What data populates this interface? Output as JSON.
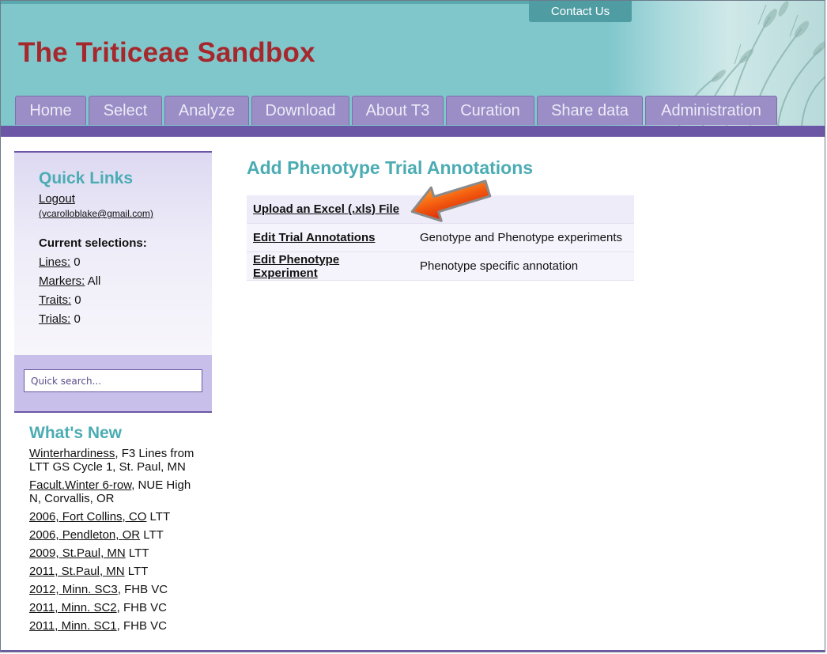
{
  "header": {
    "site_title": "The Triticeae Sandbox",
    "contact_label": "Contact Us",
    "nav_tabs": [
      "Home",
      "Select",
      "Analyze",
      "Download",
      "About T3",
      "Curation",
      "Share data",
      "Administration"
    ]
  },
  "quick_links": {
    "heading": "Quick Links",
    "logout_label": "Logout",
    "user_email": "(vcarolloblake@gmail.com)",
    "current_selections_label": "Current selections:",
    "selections": [
      {
        "label": "Lines:",
        "value": " 0"
      },
      {
        "label": "Markers:",
        "value": " All"
      },
      {
        "label": "Traits:",
        "value": " 0"
      },
      {
        "label": "Trials:",
        "value": " 0"
      }
    ]
  },
  "search": {
    "placeholder": "Quick search..."
  },
  "whats_new": {
    "heading": "What's New",
    "items": [
      {
        "link": "Winterhardiness",
        "rest": ", F3 Lines from LTT GS Cycle 1, St. Paul, MN"
      },
      {
        "link": "Facult.Winter 6-row",
        "rest": ", NUE High N, Corvallis, OR"
      },
      {
        "link": "2006, Fort Collins, CO",
        "rest": " LTT"
      },
      {
        "link": "2006, Pendleton, OR",
        "rest": " LTT"
      },
      {
        "link": "2009, St.Paul, MN",
        "rest": " LTT"
      },
      {
        "link": "2011, St.Paul, MN",
        "rest": " LTT"
      },
      {
        "link": "2012, Minn. SC3",
        "rest": ", FHB VC"
      },
      {
        "link": "2011, Minn. SC2",
        "rest": ", FHB VC"
      },
      {
        "link": "2011, Minn. SC1",
        "rest": ", FHB VC"
      }
    ]
  },
  "main": {
    "title": "Add Phenotype Trial Annotations",
    "rows": [
      {
        "action": "Upload an Excel (.xls) File",
        "description": ""
      },
      {
        "action": "Edit Trial Annotations",
        "description": "Genotype and Phenotype experiments"
      },
      {
        "action": "Edit Phenotype Experiment",
        "description": "Phenotype specific annotation"
      }
    ]
  },
  "colors": {
    "header_teal": "#80c7cc",
    "title_red": "#a5282c",
    "nav_purple": "#9b8dc6",
    "bar_purple": "#6c57a6",
    "heading_teal": "#4bacb3",
    "arrow_orange": "#f06010"
  },
  "annotation": {
    "arrow_icon": "arrow-pointing-left-icon"
  }
}
